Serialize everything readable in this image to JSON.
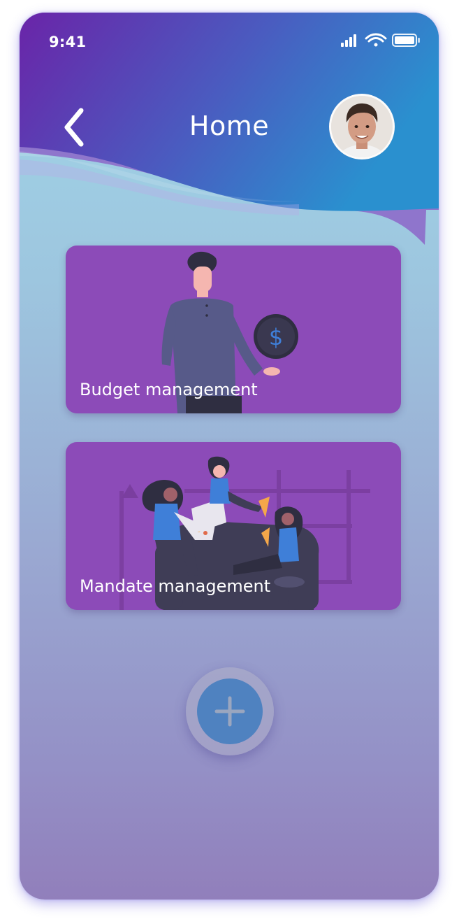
{
  "status_bar": {
    "time": "9:41"
  },
  "header": {
    "title": "Home"
  },
  "cards": [
    {
      "label": "Budget management"
    },
    {
      "label": "Mandate management"
    }
  ],
  "icons": {
    "back": "chevron-left-icon",
    "add": "plus-icon",
    "signal": "cellular-signal-icon",
    "wifi": "wifi-icon",
    "battery": "battery-icon"
  },
  "colors": {
    "header_gradient_start": "#6a24a8",
    "header_gradient_end": "#2a90cf",
    "card_background": "#8c4bb8",
    "fab": "#4f82c0"
  }
}
